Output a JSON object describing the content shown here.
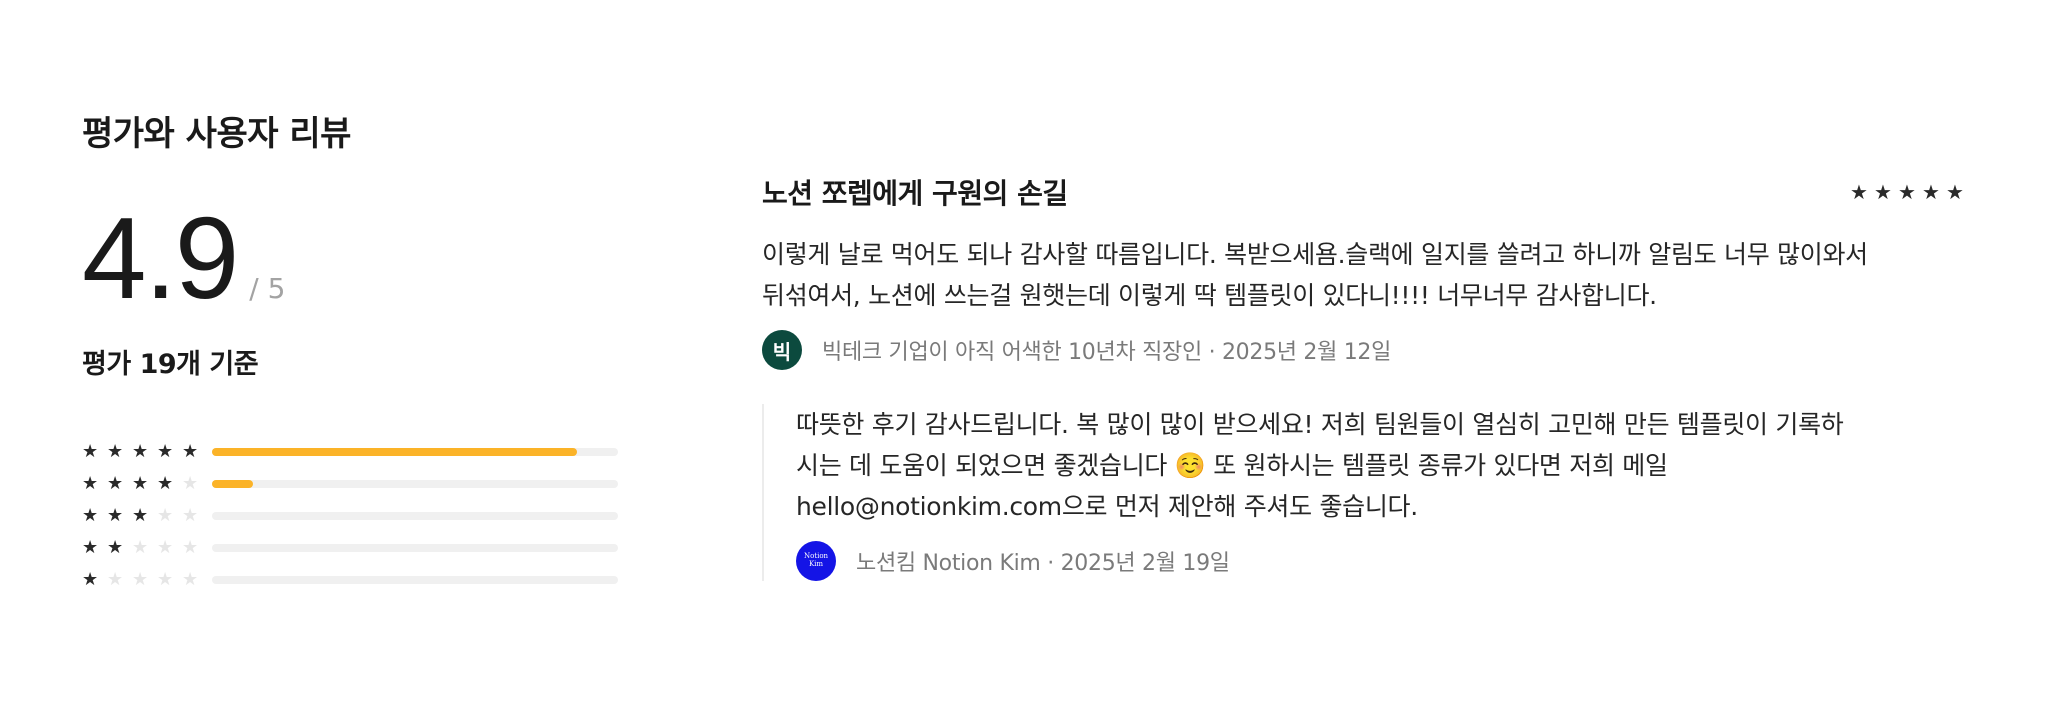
{
  "section": {
    "title": "평가와 사용자 리뷰"
  },
  "summary": {
    "score": "4.9",
    "max": "/ 5",
    "count_label": "평가 19개 기준"
  },
  "distribution": [
    {
      "stars": 5,
      "fraction": 0.9
    },
    {
      "stars": 4,
      "fraction": 0.1
    },
    {
      "stars": 3,
      "fraction": 0.0
    },
    {
      "stars": 2,
      "fraction": 0.0
    },
    {
      "stars": 1,
      "fraction": 0.0
    }
  ],
  "colors": {
    "bar_fill": "#fbb328",
    "bar_track": "#f0f0f0",
    "star_on": "#2a2a2a",
    "star_off": "#e6e6e6"
  },
  "review": {
    "title": "노션 쪼렙에게 구원의 손길",
    "rating": 5,
    "body_line1": "이렇게 날로 먹어도 되나 감사할 따름입니다. 복받으세욤.슬랙에 일지를 쓸려고 하니까 알림도 너무 많이와서",
    "body_line2": "뒤섞여서, 노션에 쓰는걸 원햇는데 이렇게 딱 템플릿이 있다니!!!! 너무너무 감사합니다.",
    "avatar_letter": "빅",
    "author_meta": "빅테크 기업이 아직 어색한 10년차 직장인 · 2025년 2월 12일"
  },
  "reply": {
    "body_line1": "따뜻한 후기 감사드립니다. 복 많이 많이 받으세요! 저희 팀원들이 열심히 고민해 만든 템플릿이 기록하",
    "body_line2": "시는 데 도움이 되었으면 좋겠습니다 ☺️ 또 원하시는 템플릿 종류가 있다면 저희 메일",
    "body_line3": "hello@notionkim.com으로 먼저 제안해 주셔도 좋습니다.",
    "avatar_line1": "Notion",
    "avatar_line2": "Kim",
    "author_meta": "노션킴 Notion Kim · 2025년 2월 19일"
  }
}
